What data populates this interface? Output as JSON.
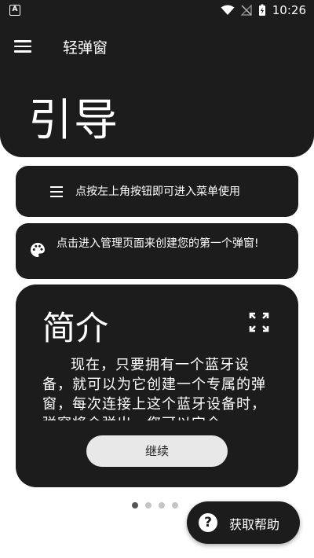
{
  "status": {
    "time": "10:26",
    "left_icon": "A"
  },
  "appbar": {
    "title": "轻弹窗"
  },
  "hero": {
    "title": "引导"
  },
  "tips": [
    {
      "icon": "menu-icon",
      "text": "点按左上角按钮即可进入菜单使用"
    },
    {
      "icon": "palette-icon",
      "text": "点击进入管理页面来创建您的第一个弹窗!"
    }
  ],
  "intro": {
    "title": "简介",
    "body": "现在，只要拥有一个蓝牙设备，就可以为它创建一个专属的弹窗，每次连接上这个蓝牙设备时，弹窗将会弹出，您可以完全",
    "continue_label": "继续"
  },
  "pager": {
    "count": 4,
    "active": 0
  },
  "help": {
    "icon": "?",
    "label": "获取帮助"
  }
}
